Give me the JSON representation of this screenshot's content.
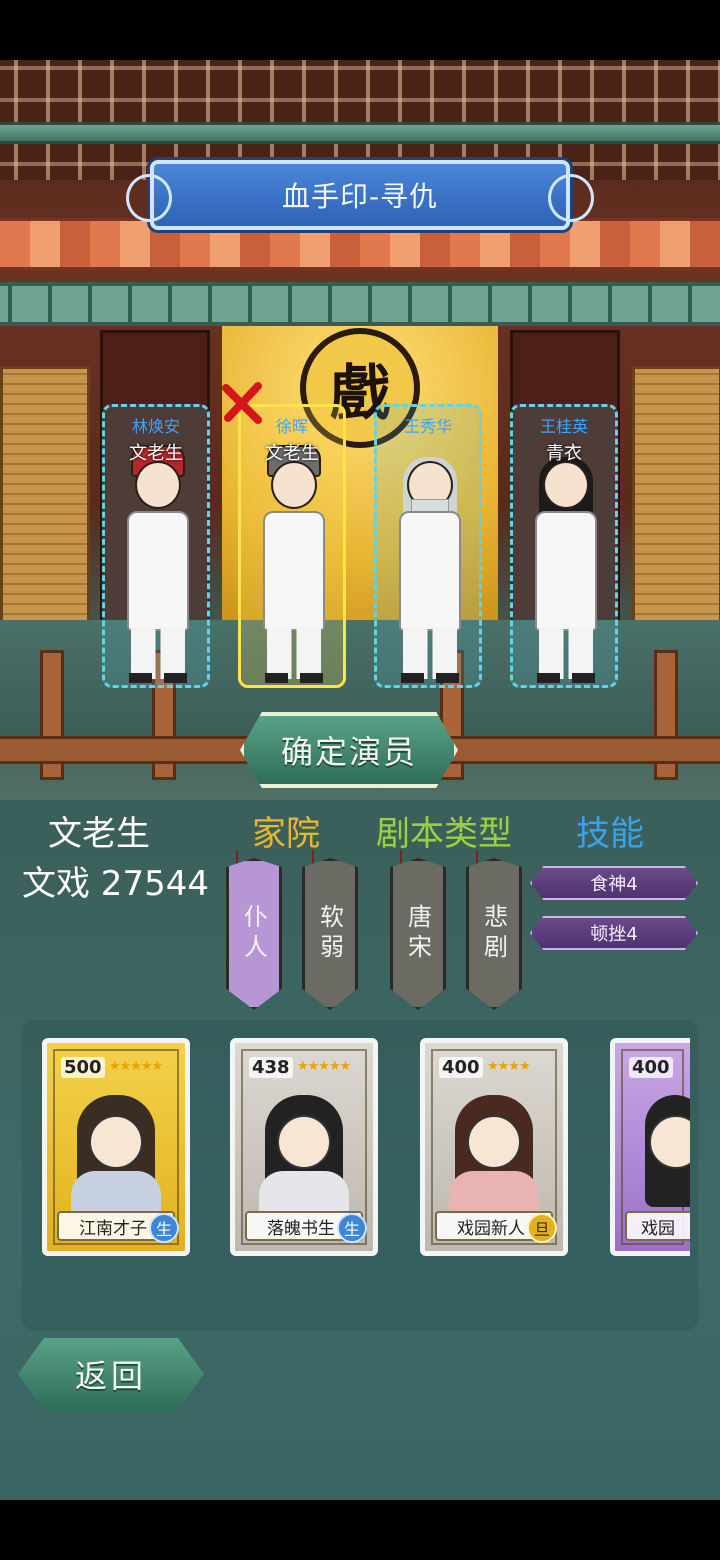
{
  "stage": {
    "title": "血手印-寻仇",
    "backdrop_glyph": "戲"
  },
  "actors": [
    {
      "name": "林焕安",
      "role": "文老生",
      "selected": false
    },
    {
      "name": "徐晖",
      "role": "文老生",
      "selected": true
    },
    {
      "name": "王秀华",
      "role": "",
      "selected": false
    },
    {
      "name": "王桂英",
      "role": "青衣",
      "selected": false
    }
  ],
  "confirm_button": "确定演员",
  "info": {
    "role": "文老生",
    "type_value": "文戏 27544"
  },
  "headers": {
    "family": "家院",
    "script_type": "剧本类型",
    "skill": "技能"
  },
  "tags": {
    "family": [
      "仆人",
      "软弱"
    ],
    "script": [
      "唐宋",
      "悲剧"
    ]
  },
  "skills": [
    "食神4",
    "顿挫4"
  ],
  "cards": [
    {
      "power": "500",
      "stars": "★★★★★",
      "label": "江南才子",
      "badge": "生",
      "rarity": "gold"
    },
    {
      "power": "438",
      "stars": "★★★★★",
      "label": "落魄书生",
      "badge": "生",
      "rarity": "grey"
    },
    {
      "power": "400",
      "stars": "★★★★",
      "label": "戏园新人",
      "badge": "旦",
      "rarity": "grey"
    },
    {
      "power": "400",
      "stars": "",
      "label": "戏园",
      "badge": "",
      "rarity": "purple"
    }
  ],
  "back_button": "返回",
  "colors": {
    "accent_green": "#2f6e5a",
    "selected_border": "#ffe34a",
    "actor_border": "#5fd3e8",
    "header_family": "#e9b62e",
    "header_script": "#9fcf3f",
    "header_skill": "#3aa3ee"
  }
}
